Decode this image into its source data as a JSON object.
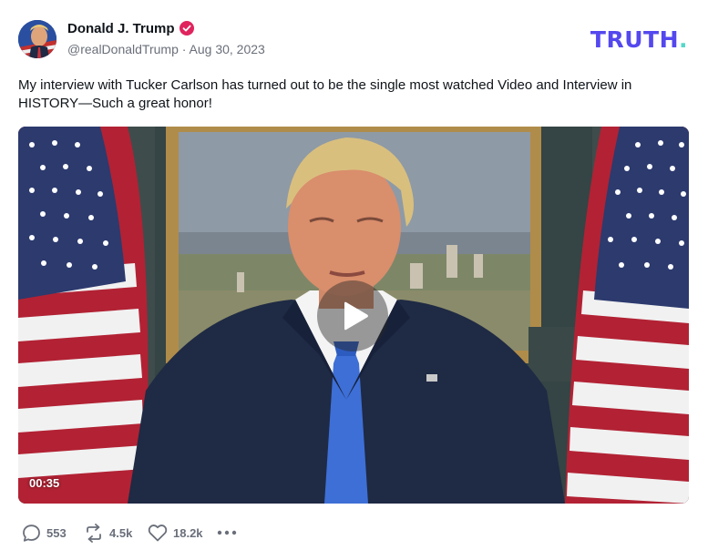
{
  "post": {
    "author_name": "Donald J. Trump",
    "handle": "@realDonaldTrump",
    "separator": " · ",
    "date": "Aug 30, 2023",
    "text": "My interview with Tucker Carlson has turned out to be the single most watched Video and Interview in HISTORY—Such a great honor!"
  },
  "brand": {
    "logo_text": "TRUTH",
    "logo_dot": ".",
    "logo_color": "#5448ee",
    "dot_color": "#54d8c8"
  },
  "video": {
    "duration": "00:35",
    "play_icon": "play-icon"
  },
  "actions": {
    "replies": "553",
    "retruths": "4.5k",
    "likes": "18.2k"
  },
  "colors": {
    "verified_badge": "#e0245e",
    "muted_text": "#6a6f7a"
  }
}
